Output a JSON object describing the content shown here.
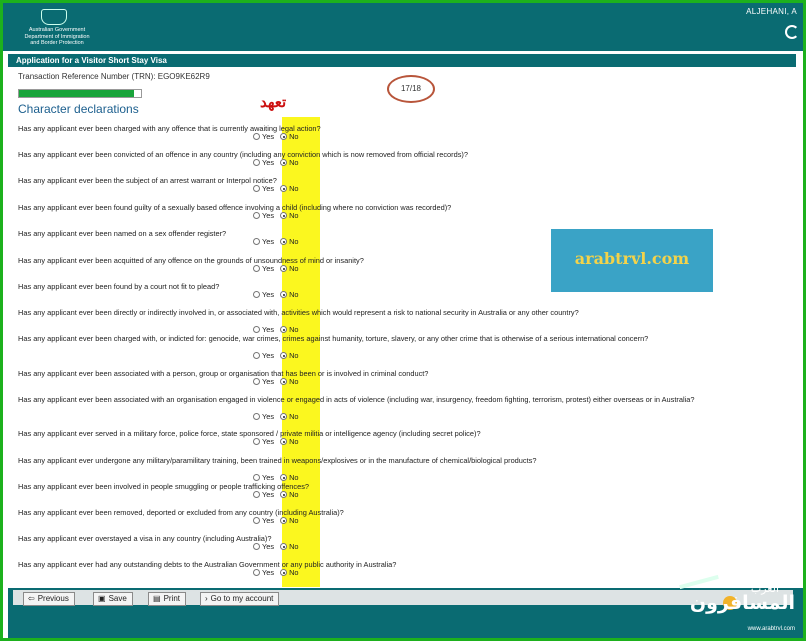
{
  "header": {
    "logo_line1": "Australian Government",
    "logo_line2": "Department of Immigration",
    "logo_line3": "and Border Protection",
    "user_name": "ALJEHANI, A"
  },
  "form": {
    "title": "Application for a Visitor Short Stay Visa",
    "trn_label": "Transaction Reference Number (TRN): EGO9KE62R9",
    "page_indicator": "17/18",
    "progress_fraction": 0.94,
    "section_title": "Character declarations",
    "annotation": "تعهد",
    "yes_label": "Yes",
    "no_label": "No",
    "questions": [
      {
        "text": "Has any applicant ever been charged with any offence that is currently awaiting legal action?",
        "answer": "No"
      },
      {
        "text": "Has any applicant ever been convicted of an offence in any country (including any conviction which is now removed from official records)?",
        "answer": "No"
      },
      {
        "text": "Has any applicant ever been the subject of an arrest warrant or Interpol notice?",
        "answer": "No"
      },
      {
        "text": "Has any applicant ever been found guilty of a sexually based offence involving a child (including where no conviction was recorded)?",
        "answer": "No"
      },
      {
        "text": "Has any applicant ever been named on a sex offender register?",
        "answer": "No"
      },
      {
        "text": "Has any applicant ever been acquitted of any offence on the grounds of unsoundness of mind or insanity?",
        "answer": "No"
      },
      {
        "text": "Has any applicant ever been found by a court not fit to plead?",
        "answer": "No"
      },
      {
        "text": "Has any applicant ever been directly or indirectly involved in, or associated with, activities which would represent a risk to national security in Australia or any other country?",
        "answer": "No"
      },
      {
        "text": "Has any applicant ever been charged with, or indicted for: genocide, war crimes, crimes against humanity, torture, slavery, or any other crime that is otherwise of a serious international concern?",
        "answer": "No"
      },
      {
        "text": "Has any applicant ever been associated with a person, group or organisation that has been or is involved in criminal conduct?",
        "answer": "No"
      },
      {
        "text": "Has any applicant ever been associated with an organisation engaged in violence or engaged in acts of violence (including war, insurgency, freedom fighting, terrorism, protest) either overseas or in Australia?",
        "answer": "No"
      },
      {
        "text": "Has any applicant ever served in a military force, police force, state sponsored / private militia or intelligence agency (including secret police)?",
        "answer": "No"
      },
      {
        "text": "Has any applicant ever undergone any military/paramilitary training, been trained in weapons/explosives or in the manufacture of chemical/biological products?",
        "answer": "No"
      },
      {
        "text": "Has any applicant ever been involved in people smuggling or people trafficking offences?",
        "answer": "No"
      },
      {
        "text": "Has any applicant ever been removed, deported or excluded from any country (including Australia)?",
        "answer": "No"
      },
      {
        "text": "Has any applicant ever overstayed a visa in any country (including Australia)?",
        "answer": "No"
      },
      {
        "text": "Has any applicant ever had any outstanding debts to the Australian Government or any public authority in Australia?",
        "answer": "No"
      }
    ]
  },
  "buttons": {
    "previous": "Previous",
    "save": "Save",
    "print": "Print",
    "account": "Go to my account"
  },
  "watermark": {
    "site": "arabtrvl.com"
  },
  "brand": {
    "small": "العرب",
    "name": "المسافرون",
    "url": "www.arabtrvl.com"
  }
}
